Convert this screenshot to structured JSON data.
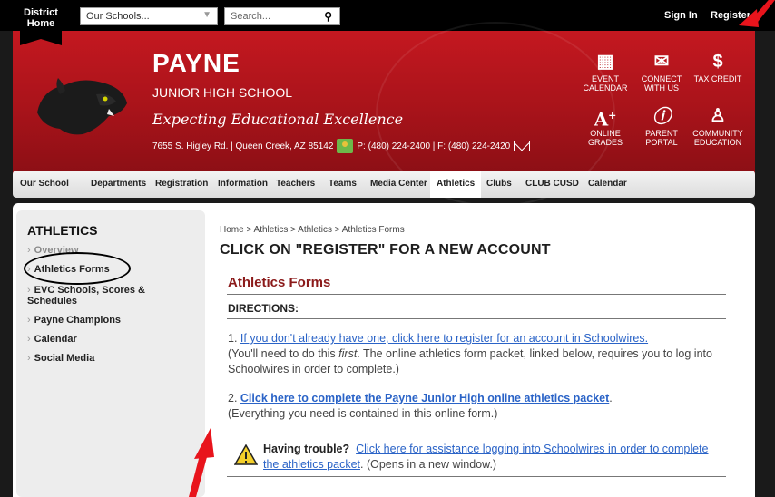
{
  "topbar": {
    "district_home": "District Home",
    "schools_select": "Our Schools...",
    "search_placeholder": "Search...",
    "sign_in": "Sign In",
    "register": "Register"
  },
  "banner": {
    "school_name": "PAYNE",
    "school_sub": "JUNIOR HIGH SCHOOL",
    "motto": "Expecting Educational Excellence",
    "address": "7655 S. Higley Rd. | Queen Creek, AZ 85142",
    "phone_fax": "P: (480) 224-2400 | F: (480) 224-2420",
    "quick_links": [
      {
        "label": "EVENT CALENDAR",
        "icon": "calendar-icon"
      },
      {
        "label": "CONNECT WITH US",
        "icon": "chat-icon"
      },
      {
        "label": "TAX CREDIT",
        "icon": "dollar-icon"
      },
      {
        "label": "ONLINE GRADES",
        "icon": "grade-icon"
      },
      {
        "label": "PARENT PORTAL",
        "icon": "info-icon"
      },
      {
        "label": "COMMUNITY EDUCATION",
        "icon": "community-icon"
      }
    ]
  },
  "nav": {
    "items": [
      "Our School",
      "Departments",
      "Registration",
      "Information",
      "Teachers",
      "Teams",
      "Media Center",
      "Athletics",
      "Clubs",
      "CLUB CUSD",
      "Calendar"
    ],
    "active": "Athletics"
  },
  "sidebar": {
    "title": "ATHLETICS",
    "items": [
      "Overview",
      "Athletics Forms",
      "EVC Schools, Scores & Schedules",
      "Payne Champions",
      "Calendar",
      "Social Media"
    ]
  },
  "main": {
    "breadcrumb": "Home  >  Athletics  >  Athletics  >  Athletics Forms",
    "page_title": "CLICK ON \"REGISTER\" FOR A NEW ACCOUNT",
    "section_title": "Athletics Forms",
    "directions": "DIRECTIONS:",
    "step1_prefix": "1. ",
    "step1_link": "If you don't already have one, click here to register for an account in Schoolwires.",
    "step1_note_a": " (You'll need to do this ",
    "step1_note_em": "first",
    "step1_note_b": ".  The online athletics form packet, linked below, requires you to log into Schoolwires in order to complete.)",
    "step2_prefix": "2.  ",
    "step2_link": "Click here to complete the Payne Junior High online athletics packet",
    "step2_suffix": ".",
    "step2_note": " (Everything you need is contained in this online form.)",
    "trouble_label": "Having trouble?",
    "trouble_link": "Click here for assistance logging into Schoolwires in order to complete the athletics packet",
    "trouble_suffix": ".  (Opens in a new window.)"
  },
  "colors": {
    "banner_red": "#c41820",
    "section_title": "#8b1a1a",
    "link_blue": "#2a63c7",
    "annotation_red": "#e8141c"
  }
}
